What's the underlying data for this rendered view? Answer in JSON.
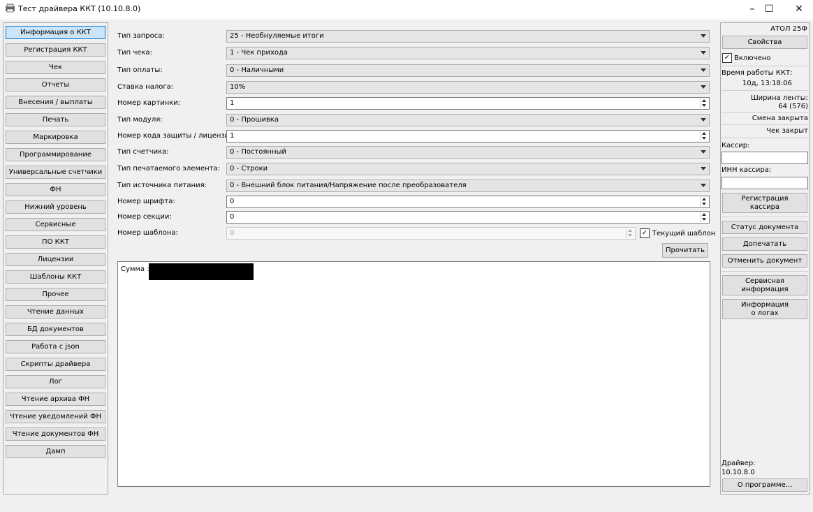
{
  "window": {
    "title": "Тест драйвера ККТ (10.10.8.0)",
    "minimize_glyph": "–",
    "maximize_glyph": "☐",
    "close_glyph": "✕"
  },
  "nav": {
    "items": [
      {
        "label": "Информация о ККТ",
        "active": true
      },
      {
        "label": "Регистрация ККТ"
      },
      {
        "label": "Чек"
      },
      {
        "label": "Отчеты"
      },
      {
        "label": "Внесения / выплаты"
      },
      {
        "label": "Печать"
      },
      {
        "label": "Маркировка"
      },
      {
        "label": "Программирование"
      },
      {
        "label": "Универсальные счетчики"
      },
      {
        "label": "ФН"
      },
      {
        "label": "Нижний уровень"
      },
      {
        "label": "Сервисные"
      },
      {
        "label": "ПО ККТ"
      },
      {
        "label": "Лицензии"
      },
      {
        "label": "Шаблоны ККТ"
      },
      {
        "label": "Прочее"
      },
      {
        "label": "Чтение данных"
      },
      {
        "label": "БД документов"
      },
      {
        "label": "Работа с json"
      },
      {
        "label": "Скрипты драйвера"
      },
      {
        "label": "Лог"
      },
      {
        "label": "Чтение архива ФН"
      },
      {
        "label": "Чтение уведомлений ФН"
      },
      {
        "label": "Чтение документов ФН"
      },
      {
        "label": "Дамп"
      }
    ]
  },
  "form": {
    "fields": [
      {
        "label": "Тип запроса:",
        "value": "25 - Необнуляемые итоги",
        "kind": "combo"
      },
      {
        "label": "Тип чека:",
        "value": "1 - Чек прихода",
        "kind": "combo"
      },
      {
        "label": "Тип оплаты:",
        "value": "0 - Наличными",
        "kind": "combo"
      },
      {
        "label": "Ставка налога:",
        "value": "10%",
        "kind": "combo"
      },
      {
        "label": "Номер картинки:",
        "value": "1",
        "kind": "spin"
      },
      {
        "label": "Тип модуля:",
        "value": "0 - Прошивка",
        "kind": "combo"
      },
      {
        "label": "Номер кода защиты / лицензии:",
        "value": "1",
        "kind": "spin"
      },
      {
        "label": "Тип счетчика:",
        "value": "0 - Постоянный",
        "kind": "combo"
      },
      {
        "label": "Тип печатаемого элемента:",
        "value": "0 - Строки",
        "kind": "combo"
      },
      {
        "label": "Тип источника питания:",
        "value": "0 - Внешний блок питания/Напряжение после преобразователя",
        "kind": "combo"
      },
      {
        "label": "Номер шрифта:",
        "value": "0",
        "kind": "spin"
      },
      {
        "label": "Номер секции:",
        "value": "0",
        "kind": "spin"
      },
      {
        "label": "Номер шаблона:",
        "value": "0",
        "kind": "spin-disabled"
      }
    ],
    "current_template_label": "Текущий шаблон",
    "current_template_checked": true,
    "read_button": "Прочитать",
    "output_label": "Сумма :"
  },
  "right": {
    "model": "АТОЛ 25Ф",
    "properties_button": "Свойства",
    "enabled_label": "Включено",
    "enabled_checked": true,
    "uptime_label": "Время работы ККТ:",
    "uptime_value": "10д, 13:18:06",
    "tape_width_label": "Ширина ленты:",
    "tape_width_value": "64 (576)",
    "shift_status": "Смена закрыта",
    "receipt_status": "Чек закрыт",
    "cashier_label": "Кассир:",
    "cashier_value": "",
    "cashier_inn_label": "ИНН кассира:",
    "cashier_inn_value": "",
    "buttons": {
      "register_cashier": "Регистрация кассира",
      "doc_status": "Статус документа",
      "reprint": "Допечатать",
      "cancel_doc": "Отменить документ",
      "service_info": "Сервисная информация",
      "log_info": "Информация о логах",
      "about": "О программе..."
    },
    "driver_label": "Драйвер:",
    "driver_version": "10.10.8.0"
  }
}
